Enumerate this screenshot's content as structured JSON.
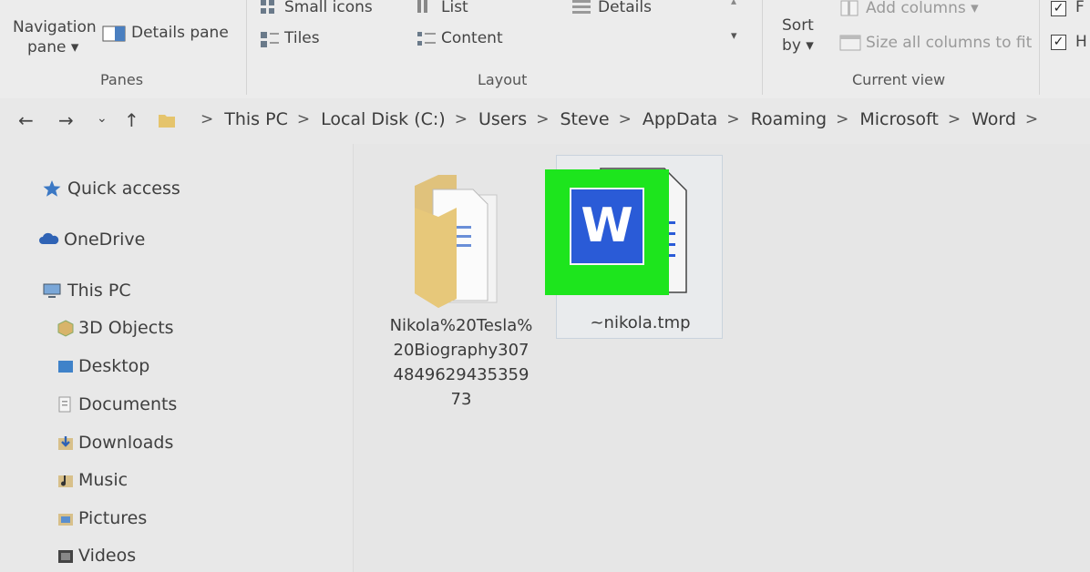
{
  "ribbon": {
    "panes": {
      "navigation_pane_line1": "Navigation",
      "navigation_pane_line2": "pane ▾",
      "details_pane": "Details pane",
      "group_label": "Panes"
    },
    "layout": {
      "small_icons": "Small icons",
      "list": "List",
      "details": "Details",
      "tiles": "Tiles",
      "content": "Content",
      "group_label": "Layout"
    },
    "current_view": {
      "sort_by_line1": "Sort",
      "sort_by_line2": "by ▾",
      "add_columns": "Add columns ▾",
      "size_all_columns": "Size all columns to fit",
      "group_label": "Current view"
    },
    "show_hide": {
      "check1_label": "F",
      "check2_label": "H"
    }
  },
  "address": {
    "crumbs": [
      "This PC",
      "Local Disk (C:)",
      "Users",
      "Steve",
      "AppData",
      "Roaming",
      "Microsoft",
      "Word"
    ]
  },
  "sidebar": {
    "quick_access": "Quick access",
    "onedrive": "OneDrive",
    "this_pc": "This PC",
    "items": [
      "3D Objects",
      "Desktop",
      "Documents",
      "Downloads",
      "Music",
      "Pictures",
      "Videos"
    ]
  },
  "files": [
    {
      "name_lines": [
        "Nikola%20Tesla%",
        "20Biography307",
        "4849629435359",
        "73"
      ],
      "kind": "folder"
    },
    {
      "name_lines": [
        "~nikola.tmp"
      ],
      "kind": "word-temp"
    }
  ],
  "word_icon_letter": "W",
  "colors": {
    "highlight_green": "#1de51d",
    "word_blue": "#2a5bd7",
    "folder_yellow": "#e7c87a"
  }
}
